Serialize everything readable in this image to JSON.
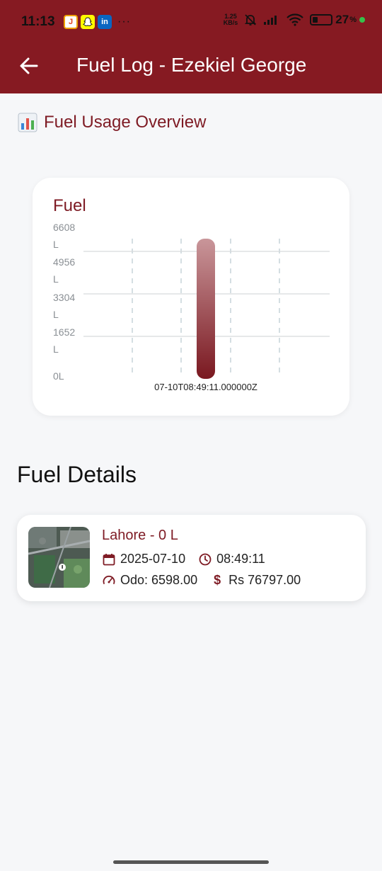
{
  "status_bar": {
    "time": "11:13",
    "apps": [
      "J",
      "ghost",
      "in"
    ],
    "more": "···",
    "speed_top": "1.25",
    "speed_bottom": "KB/s",
    "battery": "27",
    "battery_unit": "%"
  },
  "app_bar": {
    "back_icon": "arrow-left-icon",
    "title": "Fuel Log - Ezekiel George"
  },
  "overview": {
    "icon": "bar-chart-icon",
    "title": "Fuel Usage Overview"
  },
  "chart_data": {
    "type": "bar",
    "title": "Fuel",
    "categories": [
      "07-10T08:49:11.000000Z"
    ],
    "values": [
      6598
    ],
    "y_ticks": [
      "6608 L",
      "4956 L",
      "3304 L",
      "1652 L",
      "0L"
    ],
    "ylim": [
      0,
      6608
    ],
    "grid": true,
    "colors": {
      "bar_top": "#c9969a",
      "bar_bottom": "#7a1820",
      "grid": "#d7d9dc",
      "vgrid": "#a9bcc4"
    }
  },
  "details": {
    "title": "Fuel Details",
    "entries": [
      {
        "location": "Lahore - 0 L",
        "date": "2025-07-10",
        "time": "08:49:11",
        "odo": "Odo: 6598.00",
        "cost": "Rs 76797.00"
      }
    ]
  },
  "colors": {
    "primary": "#861a22",
    "accent_text": "#7e1b24",
    "background": "#f6f7f9"
  }
}
